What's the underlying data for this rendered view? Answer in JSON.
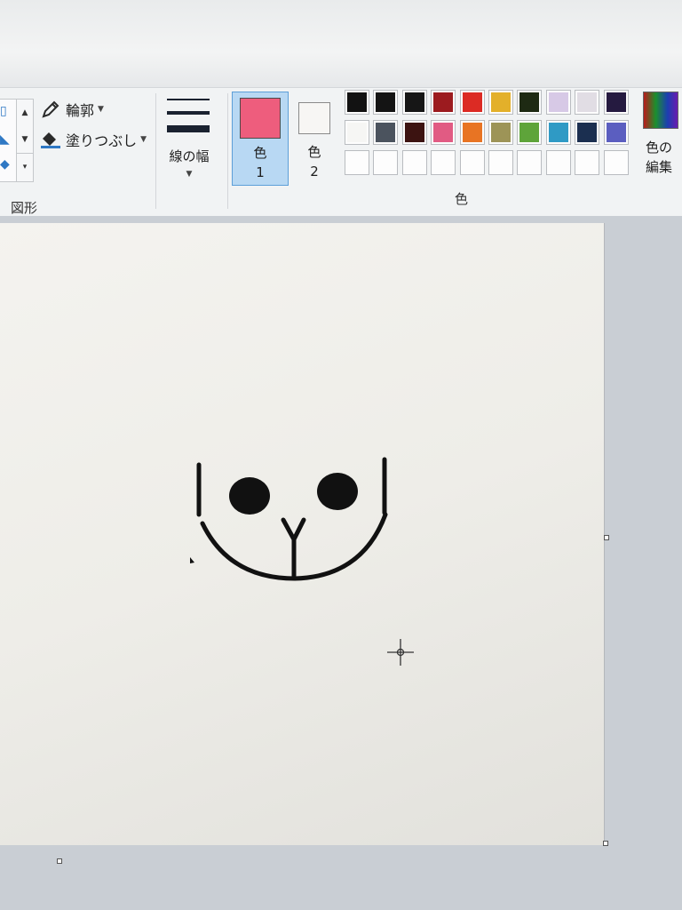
{
  "ribbon": {
    "shapes_group": {
      "label": "図形",
      "outline_label": "輪郭",
      "fill_label": "塗りつぶし"
    },
    "line_width": {
      "label": "線の幅"
    },
    "colors_group": {
      "label": "色",
      "color1": {
        "label_top": "色",
        "label_bottom": "1",
        "color": "#ee5d7d"
      },
      "color2": {
        "label_top": "色",
        "label_bottom": "2",
        "color": "#f7f6f4"
      },
      "palette": [
        [
          "#121212",
          "#141414",
          "#161616",
          "#9c1b1f",
          "#dc2b24",
          "#e3b02a",
          "#1e2a13",
          "#d7c9e6",
          "#e1dde4",
          "#251a40"
        ],
        [
          "#f6f6f4",
          "#4b535e",
          "#3c1311",
          "#e15b83",
          "#e87423",
          "#9d9457",
          "#5ea43a",
          "#2f9ac5",
          "#1b2f50",
          "#5b5ec0"
        ],
        [
          "#fdfdfd",
          "#fdfdfd",
          "#fdfdfd",
          "#fdfdfd",
          "#fdfdfd",
          "#fdfdfd",
          "#fdfdfd",
          "#fdfdfd",
          "#fdfdfd",
          "#fdfdfd"
        ]
      ],
      "edit_colors": {
        "line1": "色の",
        "line2": "編集"
      }
    }
  },
  "canvas": {
    "drawing": "face",
    "stroke_color": "#111111"
  }
}
